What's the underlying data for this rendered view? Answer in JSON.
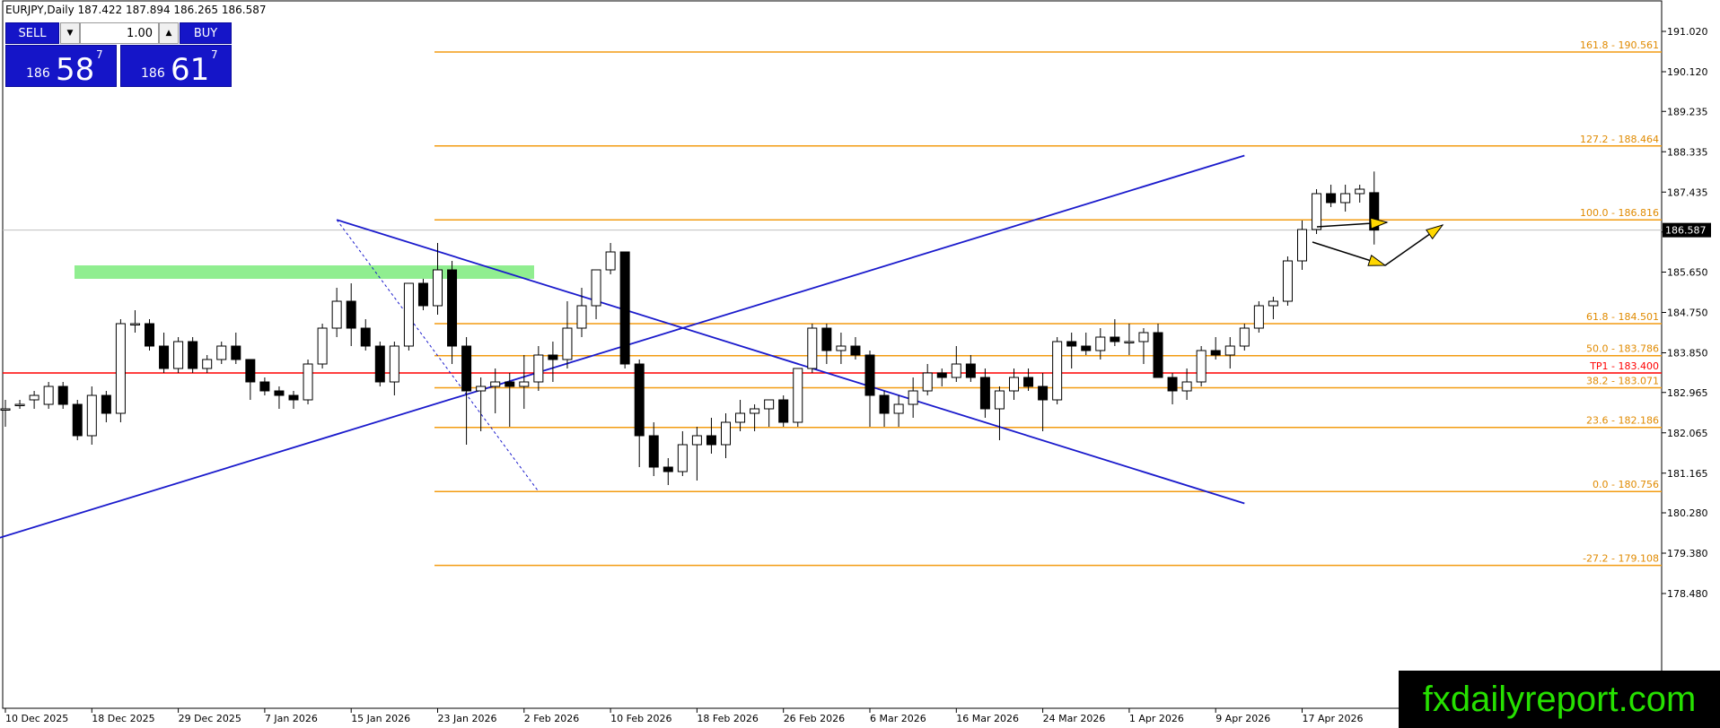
{
  "header": {
    "symbol_line": "EURJPY,Daily  187.422 187.894 186.265 186.587"
  },
  "trade_panel": {
    "sell_label": "SELL",
    "buy_label": "BUY",
    "lot_value": "1.00",
    "sell_price": {
      "prefix": "186",
      "big": "58",
      "sup": "7"
    },
    "buy_price": {
      "prefix": "186",
      "big": "61",
      "sup": "7"
    }
  },
  "watermark": "fxdailyreport.com",
  "chart_data": {
    "type": "candlestick",
    "symbol": "EURJPY",
    "timeframe": "Daily",
    "ohlc_header": {
      "open": 187.422,
      "high": 187.894,
      "low": 186.265,
      "close": 186.587
    },
    "current_price": 186.587,
    "current_price_label": "186.587",
    "y_ticks": [
      "191.020",
      "190.120",
      "189.235",
      "188.335",
      "187.435",
      "186.545",
      "185.650",
      "184.750",
      "183.850",
      "182.965",
      "182.065",
      "181.165",
      "180.280",
      "179.380",
      "178.480"
    ],
    "x_ticks": [
      "10 Dec 2025",
      "18 Dec 2025",
      "29 Dec 2025",
      "7 Jan 2026",
      "15 Jan 2026",
      "23 Jan 2026",
      "2 Feb 2026",
      "10 Feb 2026",
      "18 Feb 2026",
      "26 Feb 2026",
      "6 Mar 2026",
      "16 Mar 2026",
      "24 Mar 2026",
      "1 Apr 2026",
      "9 Apr 2026",
      "17 Apr 2026"
    ],
    "fib_levels": [
      {
        "label": "161.8 - 190.561",
        "price": 190.561
      },
      {
        "label": "127.2 - 188.464",
        "price": 188.464
      },
      {
        "label": "100.0 - 186.816",
        "price": 186.816
      },
      {
        "label": "61.8 - 184.501",
        "price": 184.501
      },
      {
        "label": "50.0 - 183.786",
        "price": 183.786
      },
      {
        "label": "38.2 - 183.071",
        "price": 183.071
      },
      {
        "label": "23.6 - 182.186",
        "price": 182.186
      },
      {
        "label": "0.0 - 180.756",
        "price": 180.756
      },
      {
        "label": "-27.2 - 179.108",
        "price": 179.108
      }
    ],
    "tp_line": {
      "label": "TP1 - 183.400",
      "price": 183.4
    },
    "supply_zone": {
      "from": 185.5,
      "to": 185.8
    },
    "trendlines": [
      {
        "name": "descending",
        "from": [
          23,
          186.816
        ],
        "to": [
          86,
          180.49
        ]
      },
      {
        "name": "ascending",
        "from": [
          -28,
          177.0
        ],
        "to": [
          86,
          188.25
        ]
      }
    ],
    "fib_anchor_line": {
      "from": [
        23,
        186.816
      ],
      "to": [
        37,
        180.756
      ]
    },
    "candles": [
      [
        182.6,
        182.8,
        182.2,
        182.6
      ],
      [
        182.7,
        182.8,
        182.6,
        182.7
      ],
      [
        182.8,
        183.0,
        182.6,
        182.9
      ],
      [
        182.7,
        183.2,
        182.6,
        183.1
      ],
      [
        183.1,
        183.2,
        182.6,
        182.7
      ],
      [
        182.7,
        182.8,
        181.9,
        182.0
      ],
      [
        182.0,
        183.1,
        181.8,
        182.9
      ],
      [
        182.9,
        183.0,
        182.3,
        182.5
      ],
      [
        182.5,
        184.6,
        182.3,
        184.5
      ],
      [
        184.5,
        184.8,
        184.3,
        184.5
      ],
      [
        184.5,
        184.6,
        183.9,
        184.0
      ],
      [
        184.0,
        184.3,
        183.4,
        183.5
      ],
      [
        183.5,
        184.2,
        183.4,
        184.1
      ],
      [
        184.1,
        184.2,
        183.4,
        183.5
      ],
      [
        183.5,
        183.8,
        183.4,
        183.7
      ],
      [
        183.7,
        184.1,
        183.6,
        184.0
      ],
      [
        184.0,
        184.3,
        183.6,
        183.7
      ],
      [
        183.7,
        183.7,
        182.8,
        183.2
      ],
      [
        183.2,
        183.3,
        182.9,
        183.0
      ],
      [
        183.0,
        183.1,
        182.6,
        182.9
      ],
      [
        182.9,
        183.0,
        182.6,
        182.8
      ],
      [
        182.8,
        183.7,
        182.7,
        183.6
      ],
      [
        183.6,
        184.5,
        183.5,
        184.4
      ],
      [
        184.4,
        185.3,
        184.2,
        185.0
      ],
      [
        185.0,
        185.4,
        184.0,
        184.4
      ],
      [
        184.4,
        184.6,
        183.9,
        184.0
      ],
      [
        184.0,
        184.1,
        183.1,
        183.2
      ],
      [
        183.2,
        184.1,
        182.9,
        184.0
      ],
      [
        184.0,
        185.4,
        183.9,
        185.4
      ],
      [
        185.4,
        185.5,
        184.8,
        184.9
      ],
      [
        184.9,
        186.3,
        184.7,
        185.7
      ],
      [
        185.7,
        185.9,
        183.6,
        184.0
      ],
      [
        184.0,
        184.2,
        181.8,
        183.0
      ],
      [
        183.0,
        183.3,
        182.1,
        183.1
      ],
      [
        183.1,
        183.5,
        182.5,
        183.2
      ],
      [
        183.2,
        183.4,
        182.2,
        183.1
      ],
      [
        183.1,
        183.8,
        182.6,
        183.2
      ],
      [
        183.2,
        184.0,
        183.0,
        183.8
      ],
      [
        183.8,
        184.1,
        183.2,
        183.7
      ],
      [
        183.7,
        185.0,
        183.5,
        184.4
      ],
      [
        184.4,
        185.3,
        184.2,
        184.9
      ],
      [
        184.9,
        185.7,
        184.6,
        185.7
      ],
      [
        185.7,
        186.3,
        185.6,
        186.1
      ],
      [
        186.1,
        186.1,
        183.5,
        183.6
      ],
      [
        183.6,
        183.7,
        181.3,
        182.0
      ],
      [
        182.0,
        182.3,
        181.1,
        181.3
      ],
      [
        181.3,
        181.5,
        180.9,
        181.2
      ],
      [
        181.2,
        182.1,
        181.1,
        181.8
      ],
      [
        181.8,
        182.2,
        181.0,
        182.0
      ],
      [
        182.0,
        182.4,
        181.6,
        181.8
      ],
      [
        181.8,
        182.5,
        181.5,
        182.3
      ],
      [
        182.3,
        182.8,
        182.1,
        182.5
      ],
      [
        182.5,
        182.7,
        182.1,
        182.6
      ],
      [
        182.6,
        182.8,
        182.2,
        182.8
      ],
      [
        182.8,
        182.9,
        182.2,
        182.3
      ],
      [
        182.3,
        183.5,
        182.2,
        183.5
      ],
      [
        183.5,
        184.5,
        183.4,
        184.4
      ],
      [
        184.4,
        184.5,
        183.6,
        183.9
      ],
      [
        183.9,
        184.3,
        183.6,
        184.0
      ],
      [
        184.0,
        184.2,
        183.7,
        183.8
      ],
      [
        183.8,
        183.9,
        182.2,
        182.9
      ],
      [
        182.9,
        183.0,
        182.2,
        182.5
      ],
      [
        182.5,
        182.9,
        182.2,
        182.7
      ],
      [
        182.7,
        183.3,
        182.4,
        183.0
      ],
      [
        183.0,
        183.6,
        182.9,
        183.4
      ],
      [
        183.4,
        183.5,
        183.1,
        183.3
      ],
      [
        183.3,
        184.0,
        183.2,
        183.6
      ],
      [
        183.6,
        183.8,
        183.2,
        183.3
      ],
      [
        183.3,
        183.5,
        182.4,
        182.6
      ],
      [
        182.6,
        183.1,
        181.9,
        183.0
      ],
      [
        183.0,
        183.5,
        182.8,
        183.3
      ],
      [
        183.3,
        183.5,
        183.0,
        183.1
      ],
      [
        183.1,
        183.4,
        182.1,
        182.8
      ],
      [
        182.8,
        184.2,
        182.7,
        184.1
      ],
      [
        184.1,
        184.3,
        183.5,
        184.0
      ],
      [
        184.0,
        184.3,
        183.8,
        183.9
      ],
      [
        183.9,
        184.4,
        183.7,
        184.2
      ],
      [
        184.2,
        184.6,
        184.0,
        184.1
      ],
      [
        184.1,
        184.5,
        183.8,
        184.1
      ],
      [
        184.1,
        184.4,
        183.6,
        184.3
      ],
      [
        184.3,
        184.5,
        183.5,
        183.3
      ],
      [
        183.3,
        183.4,
        182.7,
        183.0
      ],
      [
        183.0,
        183.5,
        182.8,
        183.2
      ],
      [
        183.2,
        184.0,
        183.1,
        183.9
      ],
      [
        183.9,
        184.2,
        183.7,
        183.8
      ],
      [
        183.8,
        184.2,
        183.5,
        184.0
      ],
      [
        184.0,
        184.5,
        183.9,
        184.4
      ],
      [
        184.4,
        185.0,
        184.3,
        184.9
      ],
      [
        184.9,
        185.1,
        184.6,
        185.0
      ],
      [
        185.0,
        186.0,
        184.9,
        185.9
      ],
      [
        185.9,
        186.8,
        185.7,
        186.6
      ],
      [
        186.6,
        187.5,
        186.5,
        187.4
      ],
      [
        187.4,
        187.6,
        187.1,
        187.2
      ],
      [
        187.2,
        187.6,
        187.0,
        187.4
      ],
      [
        187.4,
        187.6,
        187.2,
        187.5
      ],
      [
        187.422,
        187.894,
        186.265,
        186.587
      ]
    ]
  }
}
